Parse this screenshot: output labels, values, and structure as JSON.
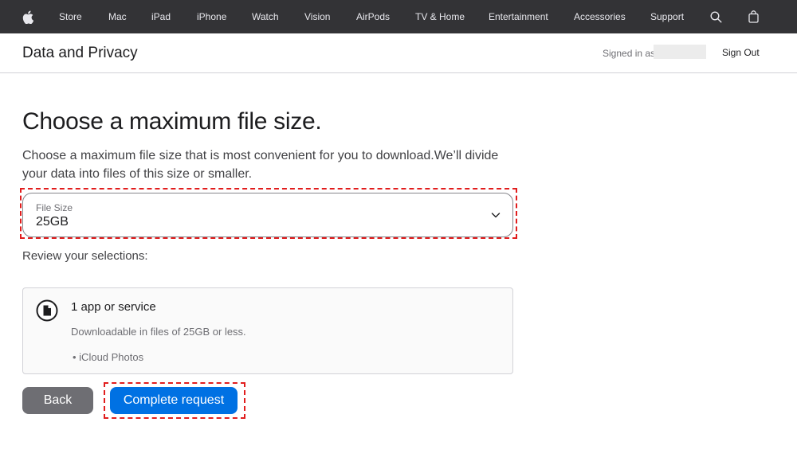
{
  "nav": {
    "items": [
      "Store",
      "Mac",
      "iPad",
      "iPhone",
      "Watch",
      "Vision",
      "AirPods",
      "TV & Home",
      "Entertainment",
      "Accessories",
      "Support"
    ],
    "icons": [
      "apple-logo",
      "search-icon",
      "bag-icon"
    ]
  },
  "subheader": {
    "title": "Data and Privacy",
    "signed_in_label": "Signed in as",
    "sign_out_label": "Sign Out"
  },
  "main": {
    "heading": "Choose a maximum file size.",
    "description": "Choose a maximum file size that is most convenient for you to download.We’ll divide your data into files of this size or smaller.",
    "file_size": {
      "label": "File Size",
      "value": "25GB"
    },
    "review_label": "Review your selections:",
    "selection_card": {
      "title": "1 app or service",
      "subtitle": "Downloadable in files of 25GB or less.",
      "items": [
        "iCloud Photos"
      ]
    },
    "buttons": {
      "back": "Back",
      "complete": "Complete request"
    }
  },
  "colors": {
    "nav_bg": "#333336",
    "primary": "#0071e3",
    "secondary_button": "#6e6e73",
    "annotation": "#e11d1d"
  }
}
